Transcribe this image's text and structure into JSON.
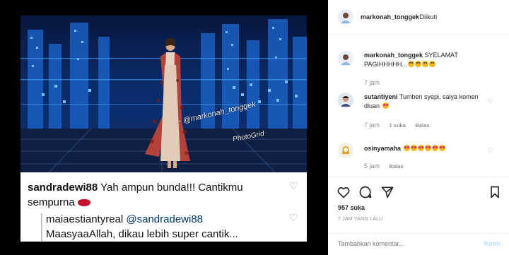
{
  "post": {
    "watermark": "- @markonah_tonggek",
    "watermark_app": "PhotoGrid",
    "screenshot_comment": {
      "user": "sandradewi88",
      "text": "Yah ampun bunda!!! Cantikmu sempurna"
    },
    "screenshot_reply": {
      "user": "maiaestiantyreal",
      "mention": "@sandradewi88",
      "text": "MaasyaaAllah, dikau lebih super cantik..."
    }
  },
  "header": {
    "username": "markonah_tonggek",
    "follow_status": "• Diikuti"
  },
  "caption": {
    "user": "markonah_tonggek",
    "text": "SYELAMAT PAGIHHHHH...",
    "time": "7 jam"
  },
  "comments": [
    {
      "user": "sutantiyeni",
      "text": "Tumben syepi, saiya komen dluan",
      "time": "7 jam",
      "likes": "1 suka",
      "reply": "Balas"
    },
    {
      "user": "osinyamaha",
      "text": "",
      "time": "5 jam",
      "reply": "Balas"
    }
  ],
  "actions": {
    "likes": "957 suka",
    "time_ago": "7 JAM YANG LALU"
  },
  "add_comment": {
    "placeholder": "Tambahkan komentar...",
    "submit": "Kirim"
  },
  "colors": {
    "link": "#00376b",
    "muted": "#8e8e8e",
    "submit_disabled": "#b2dffc"
  }
}
